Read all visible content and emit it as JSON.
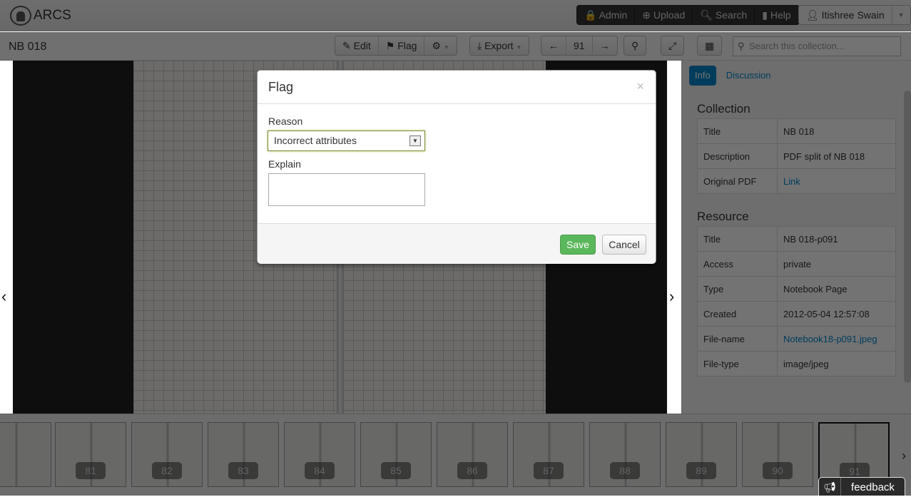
{
  "app": {
    "name": "ARCS"
  },
  "nav": {
    "items": [
      {
        "icon": "lock-icon",
        "label": "Admin"
      },
      {
        "icon": "upload-icon",
        "label": "Upload"
      },
      {
        "icon": "search-icon",
        "label": "Search"
      },
      {
        "icon": "book-icon",
        "label": "Help"
      }
    ],
    "user": "Itishree Swain"
  },
  "toolbar": {
    "title": "NB 018",
    "edit": "Edit",
    "flag": "Flag",
    "export": "Export",
    "page": "91",
    "search_placeholder": "Search this collection..."
  },
  "side": {
    "tabs": [
      "Info",
      "Discussion"
    ],
    "collection_title": "Collection",
    "collection": [
      [
        "Title",
        "NB 018"
      ],
      [
        "Description",
        "PDF split of NB 018"
      ],
      [
        "Original PDF",
        "Link"
      ]
    ],
    "resource_title": "Resource",
    "resource": [
      [
        "Title",
        "NB 018-p091"
      ],
      [
        "Access",
        "private"
      ],
      [
        "Type",
        "Notebook Page"
      ],
      [
        "Created",
        "2012-05-04 12:57:08"
      ],
      [
        "File-name",
        "Notebook18-p091.jpeg"
      ],
      [
        "File-type",
        "image/jpeg"
      ]
    ]
  },
  "thumbnails": [
    "81",
    "82",
    "83",
    "84",
    "85",
    "86",
    "87",
    "88",
    "89",
    "90",
    "91"
  ],
  "current_page": "91",
  "modal": {
    "title": "Flag",
    "reason_label": "Reason",
    "reason_value": "Incorrect attributes",
    "explain_label": "Explain",
    "explain_value": "",
    "save": "Save",
    "cancel": "Cancel"
  },
  "feedback": "feedback",
  "colors": {
    "accent": "#0088cc",
    "save": "#5bb75b",
    "overlay": "rgba(0,0,0,0.58)"
  }
}
